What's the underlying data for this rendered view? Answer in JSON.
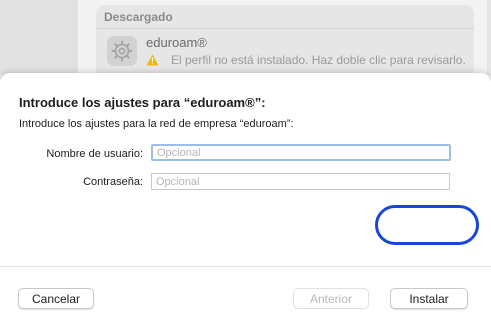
{
  "background": {
    "section_title": "Descargado",
    "profile_name": "eduroam®",
    "profile_status": "El perfil no está instalado. Haz doble clic para revisarlo."
  },
  "sheet": {
    "title": "Introduce los ajustes para “eduroam®”:",
    "description": "Introduce los ajustes para la red de empresa “eduroam”:",
    "fields": [
      {
        "label": "Nombre de usuario:",
        "placeholder": "Opcional",
        "value": ""
      },
      {
        "label": "Contraseña:",
        "placeholder": "Opcional",
        "value": ""
      }
    ],
    "buttons": {
      "cancel": "Cancelar",
      "previous": "Anterior",
      "install": "Instalar"
    }
  },
  "colors": {
    "focus_ring": "#9bbde8",
    "annotation_ring": "#1846d8",
    "warning": "#f2b705"
  },
  "icons": {
    "profile": "gear-icon",
    "warning": "warning-triangle-icon"
  }
}
